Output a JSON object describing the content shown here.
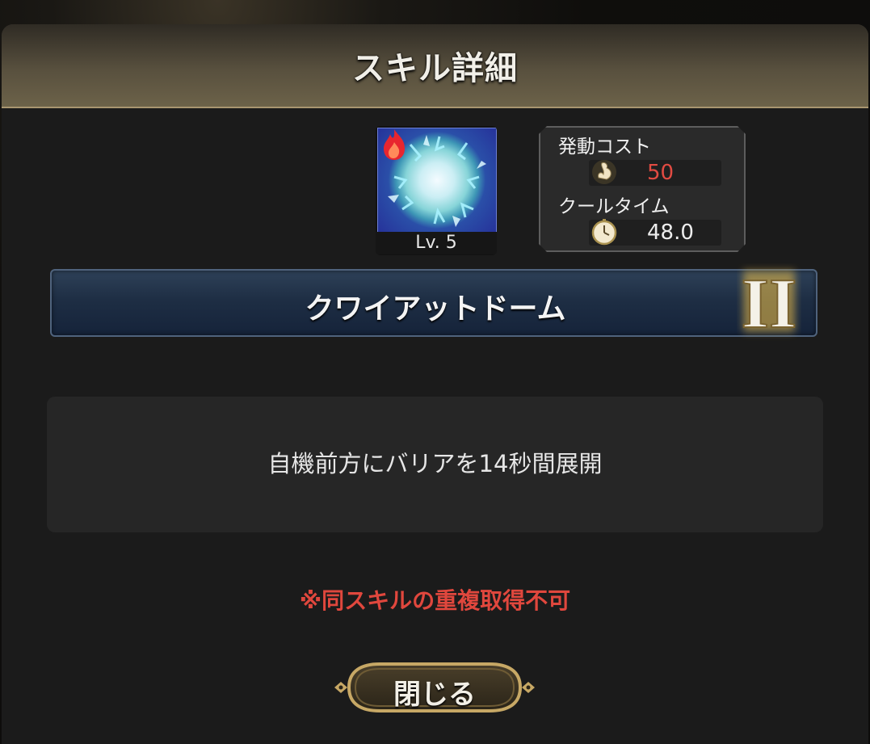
{
  "dialog": {
    "title": "スキル詳細"
  },
  "skill": {
    "level": "Lv. 5",
    "icon": "shield-dome-icon",
    "element_icon": "fire-icon",
    "name": "クワイアットドーム",
    "rank_numeral": "II",
    "description": "自機前方にバリアを14秒間展開",
    "note": "※同スキルの重複取得不可"
  },
  "stats": {
    "cost_label": "発動コスト",
    "cost_value": "50",
    "cost_icon": "swan-icon",
    "cooldown_label": "クールタイム",
    "cooldown_value": "48.0",
    "cooldown_icon": "clock-icon"
  },
  "buttons": {
    "close_label": "閉じる"
  },
  "colors": {
    "header_gold": "#6c6249",
    "cost_red": "#e14b42",
    "note_red": "#e0473d",
    "name_bar_blue": "#1e2e44",
    "rank_gold": "#f3c34a"
  }
}
